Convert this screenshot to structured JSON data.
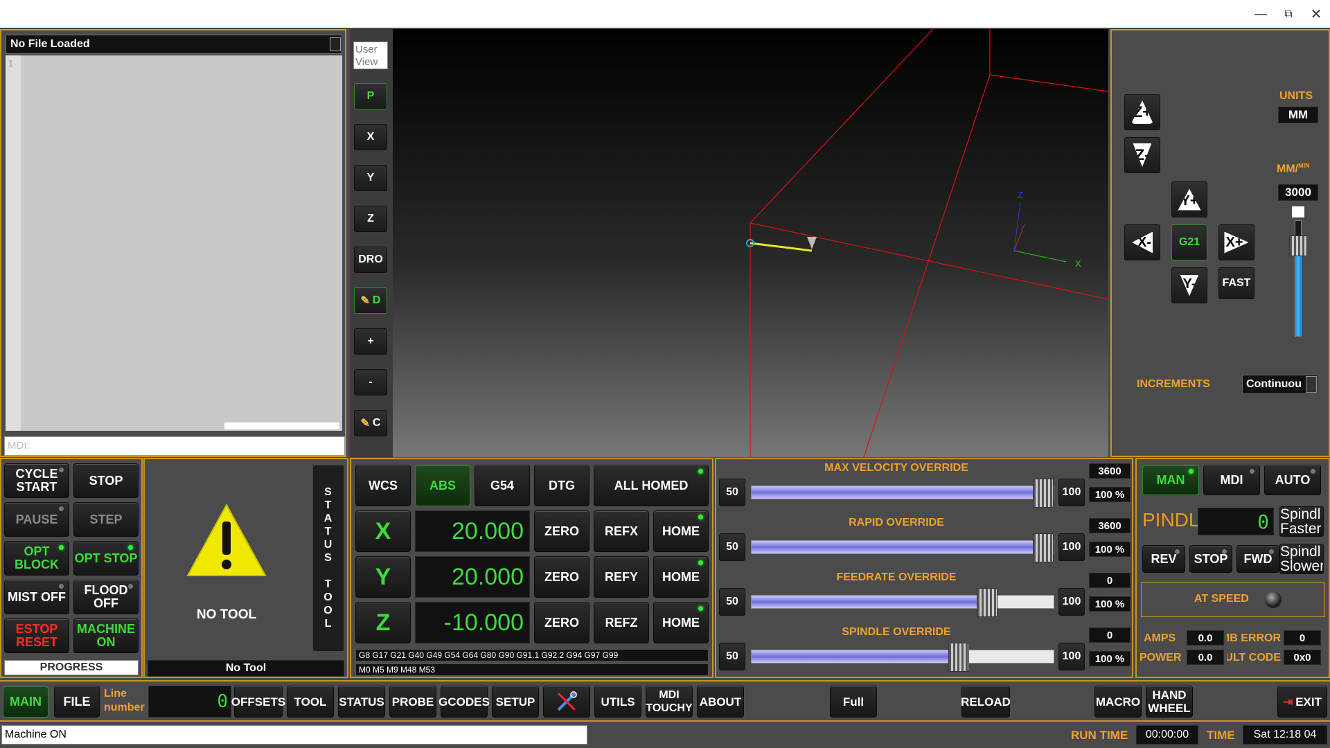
{
  "window": {
    "minimize": "—",
    "restore": "⧉",
    "close": "✕"
  },
  "editor": {
    "title": "No File Loaded",
    "line1": "1",
    "mdi_placeholder": "MDI:"
  },
  "view": {
    "user_view": "User View",
    "buttons": [
      "P",
      "X",
      "Y",
      "Z",
      "DRO",
      "D",
      "+",
      "-",
      "C"
    ],
    "axis_labels": {
      "z": "Z",
      "x": "X"
    }
  },
  "jog": {
    "z_plus": "Z+",
    "z_minus": "Z-",
    "y_plus": "Y+",
    "y_minus": "Y-",
    "x_plus": "X+",
    "x_minus": "X-",
    "g21": "G21",
    "fast": "FAST",
    "units_label": "UNITS",
    "units_value": "MM",
    "rate_label": "MM/",
    "rate_sup": "MIN",
    "rate_value": "3000",
    "rate_fraction": 0.82,
    "increments_label": "INCREMENTS",
    "increments_value": "Continuou"
  },
  "control": {
    "cycle_start": "CYCLE START",
    "stop": "STOP",
    "pause": "PAUSE",
    "step": "STEP",
    "opt_block": "OPT BLOCK",
    "opt_stop": "OPT STOP",
    "mist": "MIST OFF",
    "flood": "FLOOD OFF",
    "estop": "ESTOP RESET",
    "machine": "MACHINE ON",
    "progress": "PROGRESS"
  },
  "tool": {
    "no_tool": "NO TOOL",
    "status_tab": "STATUS TOOL",
    "no_tool_field": "No Tool"
  },
  "dro": {
    "wcs": "WCS",
    "abs": "ABS",
    "g54": "G54",
    "dtg": "DTG",
    "all_homed": "ALL HOMED",
    "zero": "ZERO",
    "home": "HOME",
    "axes": [
      {
        "name": "X",
        "value": "20.000",
        "ref": "REFX"
      },
      {
        "name": "Y",
        "value": "20.000",
        "ref": "REFY"
      },
      {
        "name": "Z",
        "value": "-10.000",
        "ref": "REFZ"
      }
    ],
    "gcodes": "G8 G17 G21 G40 G49 G54 G64 G80 G90 G91.1 G92.2 G94 G97 G99",
    "mcodes": "M0 M5 M9 M48 M53"
  },
  "overrides": [
    {
      "title": "MAX VELOCITY OVERRIDE",
      "min": "50",
      "max": "100",
      "value": "3600",
      "percent": "100 %",
      "fill": 1.0
    },
    {
      "title": "RAPID OVERRIDE",
      "min": "50",
      "max": "100",
      "value": "3600",
      "percent": "100 %",
      "fill": 1.0
    },
    {
      "title": "FEEDRATE OVERRIDE",
      "min": "50",
      "max": "100",
      "value": "0",
      "percent": "100 %",
      "fill": 0.8
    },
    {
      "title": "SPINDLE OVERRIDE",
      "min": "50",
      "max": "100",
      "value": "0",
      "percent": "100 %",
      "fill": 0.7
    }
  ],
  "spindle": {
    "man": "MAN",
    "mdi": "MDI",
    "auto": "AUTO",
    "label": "PINDL",
    "rpm_display": "0",
    "faster": "Spindl Faster",
    "slower": "Spindl Slower",
    "rev": "REV",
    "stop": "STOP",
    "fwd": "FWD",
    "at_speed": "AT SPEED",
    "amps_label": "AMPS",
    "amps": "0.0",
    "mb_error_label": "MB ERROR",
    "mb_error": "0",
    "power_label": "POWER",
    "power": "0.0",
    "fault_label": "FAULT CODE",
    "fault": "0x0"
  },
  "bottom_tabs": {
    "main": "MAIN",
    "file": "FILE",
    "line_number": "Line number",
    "line_display": "0",
    "offsets": "OFFSETS",
    "tool": "TOOL",
    "status": "STATUS",
    "probe": "PROBE",
    "gcodes": "GCODES",
    "setup": "SETUP",
    "utils": "UTILS",
    "mdi_touchy": "MDI TOUCHY",
    "about": "ABOUT",
    "full": "Full",
    "reload": "RELOAD",
    "macro": "MACRO",
    "hand_wheel": "HAND WHEEL",
    "exit": "EXIT"
  },
  "statusbar": {
    "message": "Machine ON",
    "run_time_label": "RUN TIME",
    "run_time": "00:00:00",
    "time_label": "TIME",
    "time": "Sat 12:18 04"
  }
}
